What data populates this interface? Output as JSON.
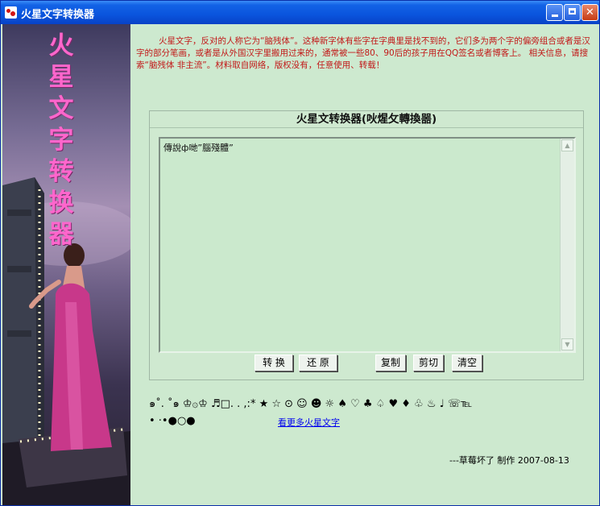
{
  "window": {
    "title": "火星文字转换器"
  },
  "sidebar": {
    "title_chars": [
      "火",
      "星",
      "文",
      "字",
      "转",
      "换",
      "器"
    ]
  },
  "intro": "火星文字，反对的人称它为“脑残体”。这种新字体有些字在字典里是找不到的，它们多为两个字的偏旁组合或者是汉字的部分笔画，或者是从外国汉字里搬用过来的，通常被一些80、90后的孩子用在QQ签名或者博客上。 相关信息，请搜索“脑残体 非主流”。材料取自网络，版权没有，任意使用、转载！",
  "panel": {
    "title": "火星文转换器(吙煋攵轉換噐)",
    "text_value": "傳說ф哋”腦殘體”",
    "buttons": {
      "convert": "转 换",
      "restore": "还 原",
      "copy": "复制",
      "cut": "剪切",
      "clear": "清空"
    }
  },
  "symbols": {
    "row1": "๑˚. ˚๑ ♔۞♔ ♬□. . ,:* ★ ☆ ⊙ ☺ ☻ ☼ ♠ ♡ ♣ ♤ ♥ ♦ ♧ ♨ ♩ ☏℡",
    "row2": "• ·•●○●"
  },
  "more_link": "看更多火星文字",
  "credit": "---草莓坏了 制作 2007-08-13"
}
